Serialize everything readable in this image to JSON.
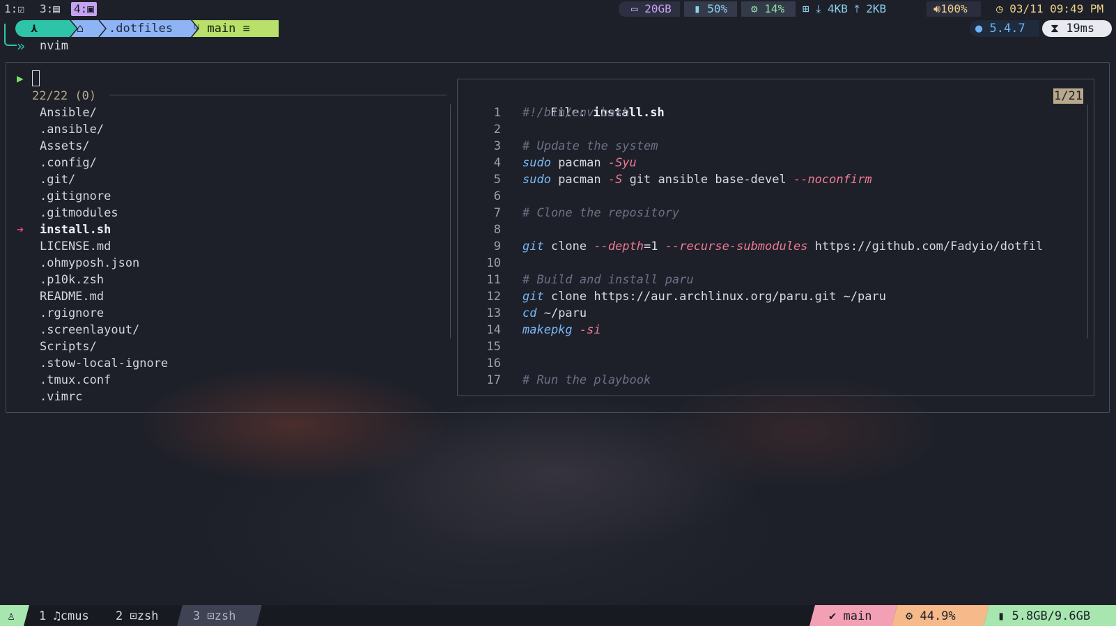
{
  "topbar": {
    "workspaces": [
      {
        "label": "1:",
        "icon": "checkbox-icon"
      },
      {
        "label": "3:",
        "icon": "file-icon"
      },
      {
        "label": "4:",
        "icon": "terminal-icon",
        "active": true
      }
    ],
    "disk": "20GB",
    "memory": "50%",
    "cpu": "14%",
    "net_down": "4KB",
    "net_up": "2KB",
    "volume": "100%",
    "datetime": "03/11 09:49 PM"
  },
  "prompt": {
    "path": ".dotfiles",
    "branch": "main",
    "branch_suffix": "≡",
    "command": "nvim",
    "version": "5.4.7",
    "duration": "19ms"
  },
  "finder": {
    "count": "22/22 (0)",
    "items": [
      "Ansible/",
      ".ansible/",
      "Assets/",
      ".config/",
      ".git/",
      ".gitignore",
      ".gitmodules",
      "install.sh",
      "LICENSE.md",
      ".ohmyposh.json",
      ".p10k.zsh",
      "README.md",
      ".rgignore",
      ".screenlayout/",
      "Scripts/",
      ".stow-local-ignore",
      ".tmux.conf",
      ".vimrc"
    ],
    "selected": "install.sh"
  },
  "preview": {
    "file_label": "File:",
    "file_name": "install.sh",
    "position": "1/21",
    "line_numbers": [
      "1",
      "2",
      "3",
      "4",
      "5",
      "6",
      "7",
      "8",
      "9",
      "10",
      "11",
      "12",
      "13",
      "14",
      "15",
      "16",
      "17"
    ]
  },
  "statusbar": {
    "windows": [
      {
        "index": "1",
        "name": "cmus"
      },
      {
        "index": "2",
        "name": "zsh"
      },
      {
        "index": "3",
        "name": "zsh"
      }
    ],
    "branch": "main",
    "cpu": "44.9%",
    "memory": "5.8GB/9.6GB"
  },
  "colors": {
    "accent_teal": "#2ec4a8",
    "accent_blue": "#8fb4f5",
    "accent_green": "#b8e06a",
    "accent_pink": "#f4a0b4",
    "accent_orange": "#f5b98a",
    "accent_mint": "#a8e6b0"
  }
}
